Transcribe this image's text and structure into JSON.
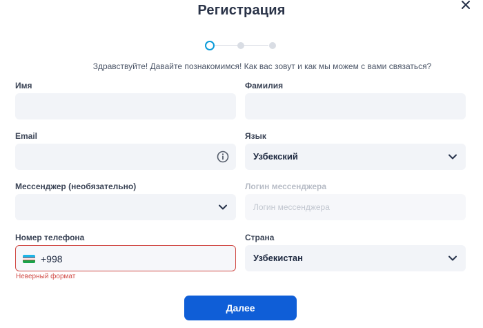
{
  "title": "Регистрация",
  "intro": "Здравствуйте! Давайте познакомимся! Как вас зовут и как мы можем с вами связаться?",
  "stepper": {
    "current": 1,
    "total": 3
  },
  "fields": {
    "first_name": {
      "label": "Имя",
      "value": ""
    },
    "last_name": {
      "label": "Фамилия",
      "value": ""
    },
    "email": {
      "label": "Email",
      "value": ""
    },
    "language": {
      "label": "Язык",
      "value": "Узбекский"
    },
    "messenger": {
      "label": "Мессенджер (необязательно)",
      "value": ""
    },
    "messenger_login": {
      "label": "Логин мессенджера",
      "placeholder": "Логин мессенджера"
    },
    "phone": {
      "label": "Номер телефона",
      "code": "+998",
      "error": "Неверный формат"
    },
    "country": {
      "label": "Страна",
      "value": "Узбекистан"
    }
  },
  "next_button": "Далее",
  "colors": {
    "accent": "#0f5ed7",
    "error": "#d14b46",
    "step_active": "#0a9bd9"
  }
}
